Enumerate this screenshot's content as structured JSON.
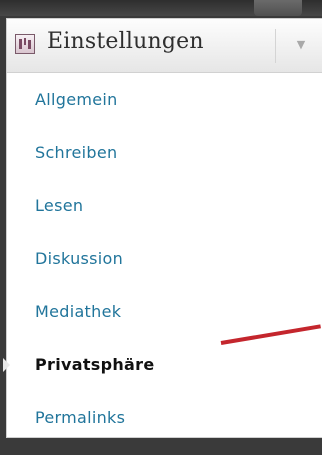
{
  "header": {
    "title": "Einstellungen",
    "icon": "settings-icon",
    "toggle_icon": "triangle-down-icon"
  },
  "menu": {
    "items": [
      {
        "label": "Allgemein"
      },
      {
        "label": "Schreiben"
      },
      {
        "label": "Lesen"
      },
      {
        "label": "Diskussion"
      },
      {
        "label": "Mediathek"
      },
      {
        "label": "Privatsphäre",
        "current": true
      },
      {
        "label": "Permalinks"
      }
    ]
  },
  "colors": {
    "link": "#21759b",
    "current": "#111111",
    "annotation_arrow": "#c4262d",
    "background": "#3a3a3a"
  }
}
